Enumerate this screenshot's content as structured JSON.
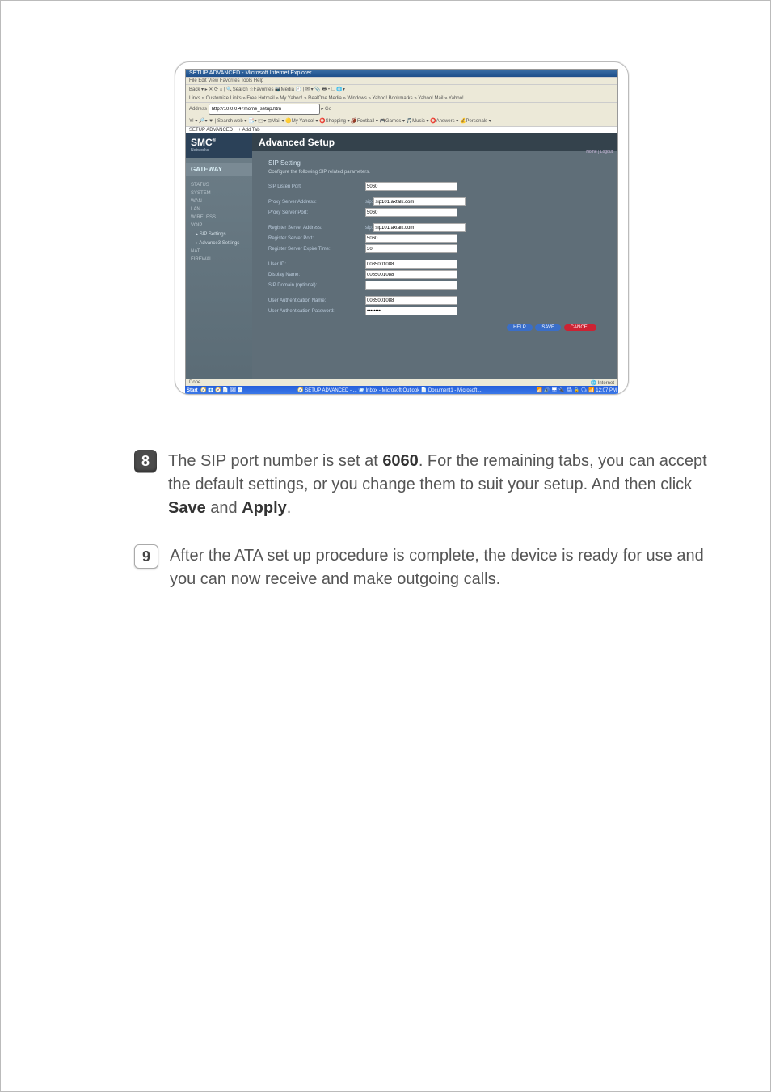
{
  "ie": {
    "title": "SETUP ADVANCED - Microsoft Internet Explorer",
    "menubar": "File   Edit   View   Favorites   Tools   Help",
    "toolbar": "Back ▾  ▸  ✕  ⟳  ⌂  | 🔍Search  ☆Favorites  📷Media  🕘  | ✉ ▾ 📎 🖶 ▾ ▢ 🌐▾",
    "links": "Links  » Customize Links  » Free Hotmail  » My Yahoo!  » RealOne Media  » Windows  » Yahoo! Bookmarks  » Yahoo! Mail  » Yahoo!",
    "address_label": "Address",
    "address_value": "http://10.0.0.47/home_setup.htm",
    "address_go": "▸ Go",
    "yahoobar": "Y! ▾ 🔎▾           ▼  | Search web ▾  📑▾  🖂▾  ⊟Mail ▾ 🟡My Yahoo! ▾ ⭕Shopping ▾ 🏈Football ▾ 🎮Games ▾ 🎵Music ▾ ⭕Answers ▾ 💰Personals ▾",
    "tab": "SETUP ADVANCED",
    "addtab": "+ Add Tab",
    "status_left": "Done",
    "status_right": "🌐 Internet",
    "task_start": "Start",
    "task_items": "🧭 📧 🧭 📄 🖼 🧾",
    "task_right": "📶 🔊 🖥 🔌 🖨 🔒 🗣 📶   12:07 PM",
    "task_center": "🧭 SETUP ADVANCED - ...   📨 Inbox - Microsoft Outlook   📄 Document1 - Microsoft ..."
  },
  "smc": {
    "logo": "SMC",
    "logo_sub": "Networks",
    "gateway": "GATEWAY",
    "nav": {
      "status": "STATUS",
      "system": "SYSTEM",
      "wan": "WAN",
      "lan": "LAN",
      "wireless": "WIRELESS",
      "voip": "VOIP",
      "sip": "SIP Settings",
      "adv": "Advance3 Settings",
      "nat": "NAT",
      "firewall": "FIREWALL"
    },
    "header": "Advanced Setup",
    "home_logout": "Home | Logout",
    "panel_title": "SIP Setting",
    "panel_sub": "Configure the following SIP related parameters.",
    "labels": {
      "sip_listen_port": "SIP Listen Port:",
      "proxy_addr": "Proxy Server Address:",
      "proxy_port": "Proxy Server Port:",
      "reg_addr": "Register Server Address:",
      "reg_port": "Register Server Port:",
      "reg_expire": "Register Server Expire Time:",
      "user_id": "User ID:",
      "display_name": "Display Name:",
      "sip_domain": "SIP Domain (optional):",
      "auth_name": "User Authentication Name:",
      "auth_pass": "User Authentication Password:"
    },
    "prefix_sip": "sip:",
    "values": {
      "sip_listen_port": "5060",
      "proxy_addr": "sip101.axtalk.com",
      "proxy_port": "5060",
      "reg_addr": "sip101.axtalk.com",
      "reg_port": "5060",
      "reg_expire": "30",
      "user_id": "0085001088",
      "display_name": "0085001088",
      "sip_domain": "",
      "auth_name": "0085001088",
      "auth_pass": "••••••••"
    },
    "buttons": {
      "help": "HELP",
      "save": "SAVE",
      "cancel": "CANCEL"
    }
  },
  "steps": {
    "n8": "8",
    "n9": "9",
    "t8_a": "The SIP port number is set at ",
    "t8_b": "6060",
    "t8_c": ". For the remaining tabs, you can accept the default settings, or you change them to suit your setup. And then click ",
    "t8_d": "Save",
    "t8_e": " and ",
    "t8_f": "Apply",
    "t8_g": ".",
    "t9": "After the ATA set up procedure is complete, the device is ready for use and you can now receive and make outgoing calls."
  }
}
